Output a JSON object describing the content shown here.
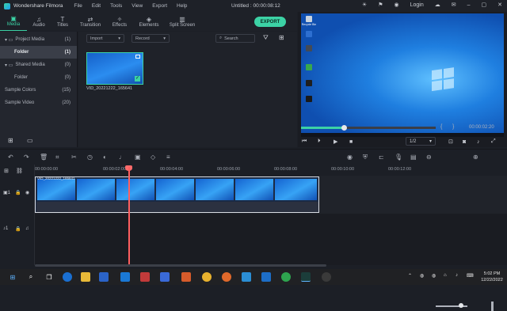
{
  "titlebar": {
    "app_name": "Wondershare Filmora",
    "menu": [
      "File",
      "Edit",
      "Tools",
      "View",
      "Export",
      "Help"
    ],
    "document_title": "Untitled : 00:00:08:12",
    "login": "Login"
  },
  "module_tabs": [
    {
      "label": "Media",
      "icon": "media-icon"
    },
    {
      "label": "Audio",
      "icon": "audio-icon"
    },
    {
      "label": "Titles",
      "icon": "titles-icon"
    },
    {
      "label": "Transition",
      "icon": "transition-icon"
    },
    {
      "label": "Effects",
      "icon": "effects-icon"
    },
    {
      "label": "Elements",
      "icon": "elements-icon"
    },
    {
      "label": "Split Screen",
      "icon": "split-screen-icon"
    }
  ],
  "export_label": "EXPORT",
  "media_tree": [
    {
      "label": "Project Media",
      "count": "(1)"
    },
    {
      "label": "Folder",
      "count": "(1)"
    },
    {
      "label": "Shared Media",
      "count": "(0)"
    },
    {
      "label": "Folder",
      "count": "(0)"
    },
    {
      "label": "Sample Colors",
      "count": "(15)"
    },
    {
      "label": "Sample Video",
      "count": "(20)"
    }
  ],
  "media_toolbar": {
    "import_label": "Import",
    "record_label": "Record",
    "search_placeholder": "Search"
  },
  "clip": {
    "name": "VID_20221222_165641"
  },
  "preview": {
    "time": "00:00:02:20",
    "progress": 0.32,
    "page": "1/2",
    "desktop_icons": [
      "Recycle Bin",
      "",
      "",
      "",
      "",
      "",
      ""
    ]
  },
  "timeline": {
    "ruler_labels": [
      "00:00:00:00",
      "00:00:02:00",
      "00:00:04:00",
      "00:00:06:00",
      "00:00:08:00",
      "00:00:10:00",
      "00:00:12:00"
    ],
    "clip_label": "VID_20221222_165641"
  },
  "taskbar": {
    "time": "5:02 PM",
    "date": "12/22/2022"
  }
}
